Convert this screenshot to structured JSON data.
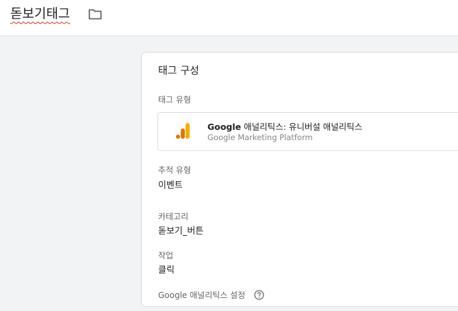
{
  "header": {
    "tag_name": "돋보기태그",
    "folder_icon": "folder-icon"
  },
  "card": {
    "title": "태그 구성",
    "tag_type": {
      "label": "태그 유형",
      "name_bold": "Google",
      "name_rest": " 애널리틱스: 유니버설 애널리틱스",
      "platform": "Google Marketing Platform",
      "icon": "google-analytics-icon",
      "icon_colors": [
        "#e37400",
        "#f9ab00"
      ]
    },
    "fields": [
      {
        "label": "추적 유형",
        "value": "이벤트"
      },
      {
        "label": "카테고리",
        "value": "돋보기_버튼"
      },
      {
        "label": "작업",
        "value": "클릭"
      }
    ],
    "settings": {
      "label": "Google 애널리틱스 설정",
      "help_icon": "help-icon"
    }
  },
  "colors": {
    "workspace_bg": "#f1f3f4",
    "card_border": "#dadce0",
    "spellcheck_underline": "#d93025"
  }
}
